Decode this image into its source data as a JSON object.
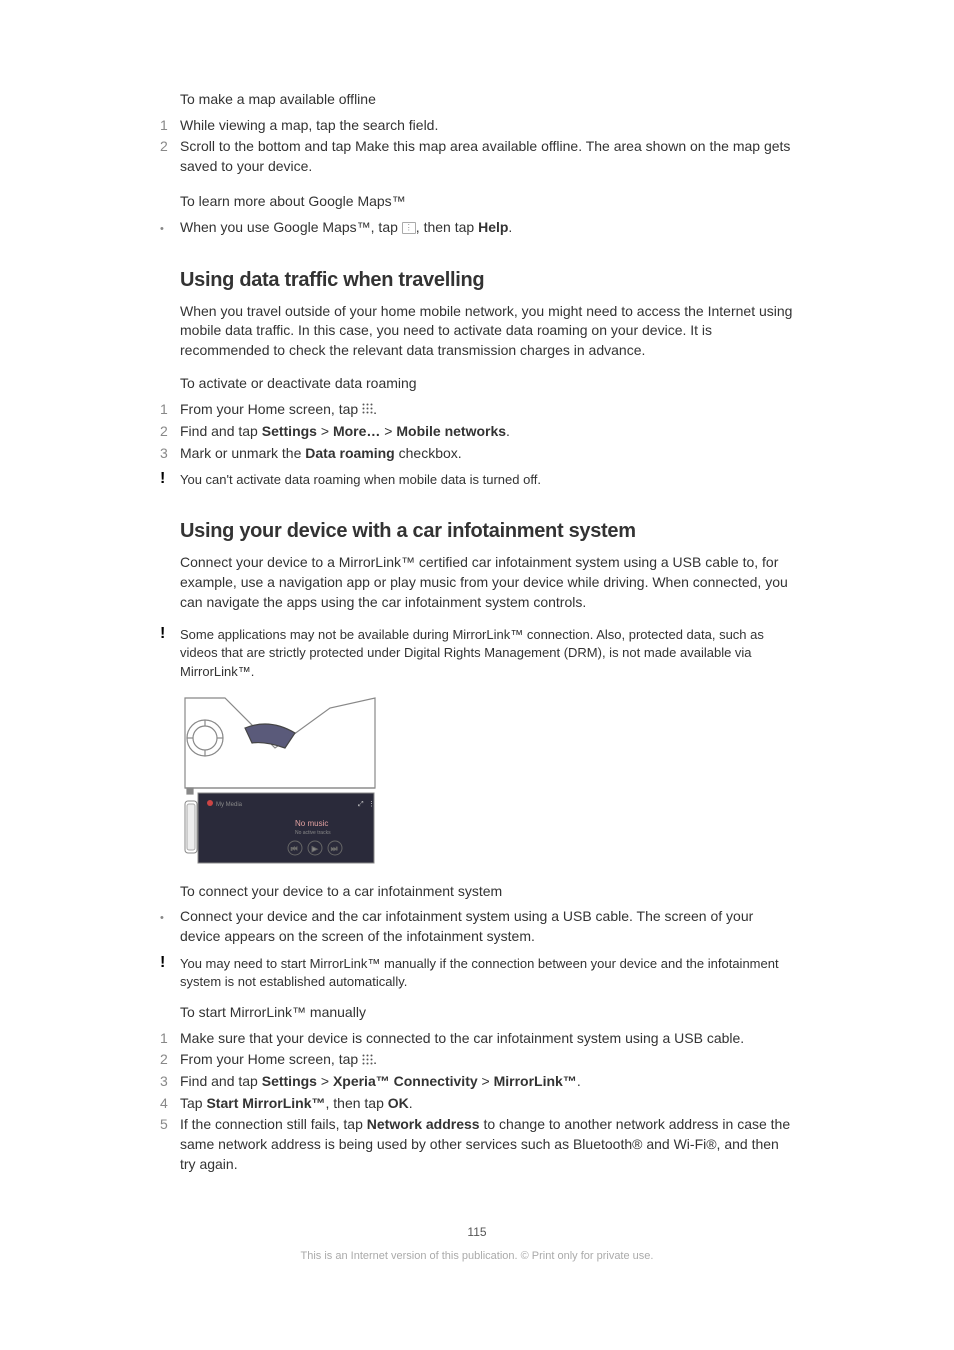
{
  "maps_offline": {
    "title": "To make a map available offline",
    "steps": [
      "While viewing a map, tap the search field.",
      "Scroll to the bottom and tap Make this map area available offline. The area shown on the map gets saved to your device."
    ]
  },
  "maps_learn": {
    "title": "To learn more about Google Maps™",
    "bullet_pre": "When you use Google Maps™, tap ",
    "bullet_post": ", then tap ",
    "help": "Help",
    "period": "."
  },
  "travel": {
    "heading": "Using data traffic when travelling",
    "paragraph": "When you travel outside of your home mobile network, you might need to access the Internet using mobile data traffic. In this case, you need to activate data roaming on your device. It is recommended to check the relevant data transmission charges in advance.",
    "subtitle": "To activate or deactivate data roaming",
    "s1_pre": "From your Home screen, tap ",
    "s1_post": ".",
    "s2_pre": "Find and tap ",
    "s2_settings": "Settings",
    "s2_gt1": " > ",
    "s2_more": "More…",
    "s2_gt2": " > ",
    "s2_mobile": "Mobile networks",
    "s2_post": ".",
    "s3_pre": "Mark or unmark the ",
    "s3_bold": "Data roaming",
    "s3_post": " checkbox.",
    "note": "You can't activate data roaming when mobile data is turned off."
  },
  "car": {
    "heading": "Using your device with a car infotainment system",
    "paragraph": "Connect your device to a MirrorLink™ certified car infotainment system using a USB cable to, for example, use a navigation app or play music from your device while driving. When connected, you can navigate the apps using the car infotainment system controls.",
    "note1": "Some applications may not be available during MirrorLink™ connection. Also, protected data, such as videos that are strictly protected under Digital Rights Management (DRM), is not made available via MirrorLink™.",
    "connect_title": "To connect your device to a car infotainment system",
    "connect_bullet": "Connect your device and the car infotainment system using a USB cable. The screen of your device appears on the screen of the infotainment system.",
    "note2": "You may need to start MirrorLink™ manually if the connection between your device and the infotainment system is not established automatically.",
    "manual_title": "To start MirrorLink™ manually",
    "m1": "Make sure that your device is connected to the car infotainment system using a USB cable.",
    "m2_pre": "From your Home screen, tap ",
    "m2_post": ".",
    "m3_pre": "Find and tap ",
    "m3_settings": "Settings",
    "m3_gt1": " > ",
    "m3_xperia": "Xperia™ Connectivity",
    "m3_gt2": " > ",
    "m3_mirror": "MirrorLink™",
    "m3_post": ".",
    "m4_pre": "Tap ",
    "m4_start": "Start MirrorLink™",
    "m4_mid": ", then tap ",
    "m4_ok": "OK",
    "m4_post": ".",
    "m5_pre": "If the connection still fails, tap ",
    "m5_bold": "Network address",
    "m5_post": " to change to another network address in case the same network address is being used by other services such as Bluetooth® and Wi-Fi®, and then try again."
  },
  "page_number": "115",
  "footer": "This is an Internet version of this publication. © Print only for private use."
}
